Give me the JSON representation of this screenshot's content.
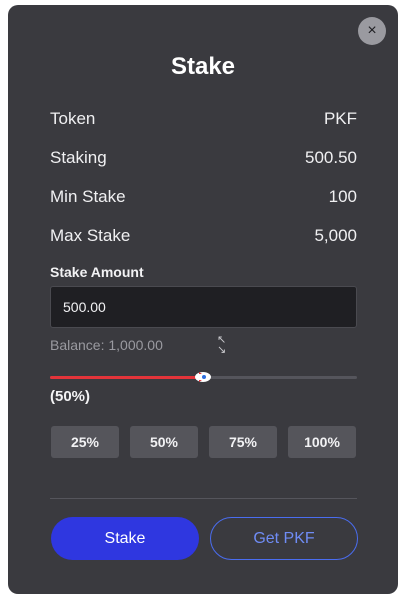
{
  "modal": {
    "title": "Stake",
    "close_icon": "×"
  },
  "info": [
    {
      "label": "Token",
      "value": "PKF"
    },
    {
      "label": "Staking",
      "value": "500.50"
    },
    {
      "label": "Min Stake",
      "value": "100"
    },
    {
      "label": "Max Stake",
      "value": "5,000"
    }
  ],
  "stake_amount": {
    "label": "Stake Amount",
    "value": "500.00",
    "balance": "Balance: 1,000.00"
  },
  "slider": {
    "percent": 50,
    "percent_label": "(50%)",
    "fill_color": "#e3343a",
    "thumb_icon": "rocket-icon"
  },
  "percent_buttons": [
    "25%",
    "50%",
    "75%",
    "100%"
  ],
  "actions": {
    "stake_label": "Stake",
    "get_label": "Get PKF",
    "stake_color": "#2f37e0",
    "get_color": "#4a6df0"
  }
}
